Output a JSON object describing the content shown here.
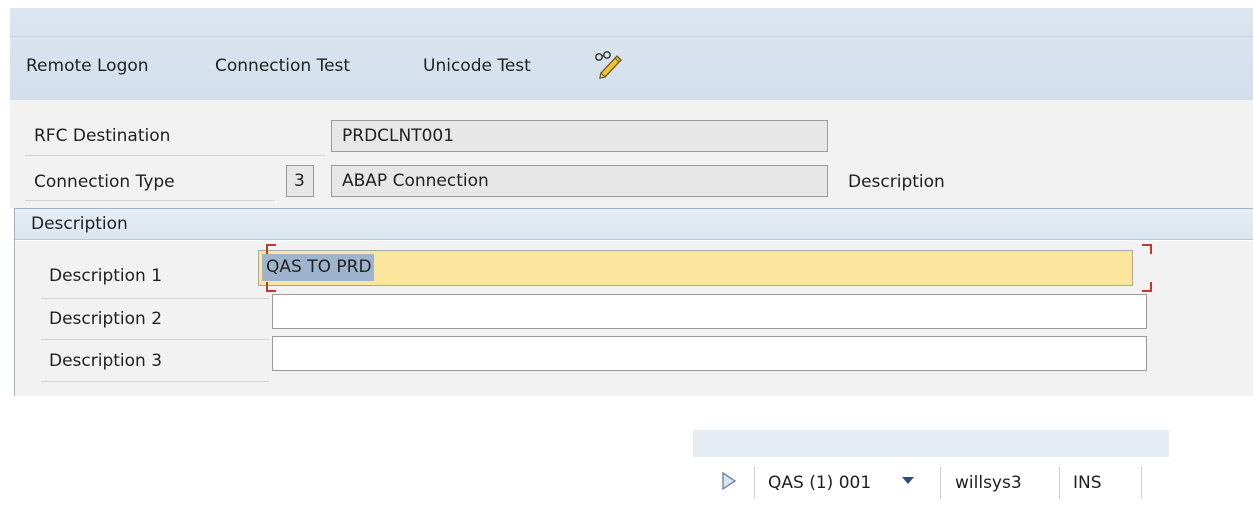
{
  "toolbar": {
    "remote_logon": "Remote Logon",
    "connection_test": "Connection Test",
    "unicode_test": "Unicode Test",
    "edit_icon": "pencil-eyeglasses-icon"
  },
  "header": {
    "rfc_destination_label": "RFC Destination",
    "rfc_destination_value": "PRDCLNT001",
    "connection_type_label": "Connection Type",
    "connection_type_code": "3",
    "connection_type_value": "ABAP Connection",
    "description_label": "Description"
  },
  "description_group": {
    "title": "Description",
    "fields": [
      {
        "label": "Description 1",
        "value": "QAS TO PRD"
      },
      {
        "label": "Description 2",
        "value": ""
      },
      {
        "label": "Description 3",
        "value": ""
      }
    ]
  },
  "status_bar": {
    "system": "QAS (1) 001",
    "server": "willsys3",
    "mode": "INS"
  },
  "colors": {
    "toolbar_bg": "#d2dfec",
    "active_field": "#fbe69e",
    "selection": "#9eb4cc",
    "focus_corners": "#c0392b"
  }
}
